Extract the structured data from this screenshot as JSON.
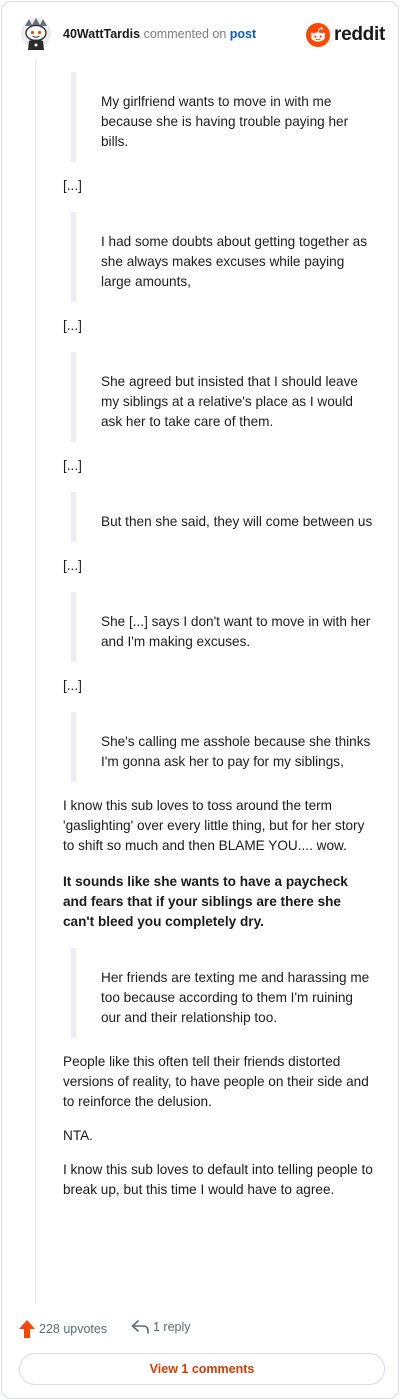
{
  "header": {
    "username": "40WattTardis",
    "action": "commented on",
    "post_link": "post",
    "brand": "reddit",
    "avatar_icon": "snoo-avatar-icon",
    "brand_icon": "reddit-logo-icon",
    "brand_color": "#ff4500"
  },
  "comment": {
    "quote1": "My girlfriend wants to move in with me because she is having trouble paying her bills.",
    "ellipsis1": "[...]",
    "quote2": "I had some doubts about getting together as she always makes excuses while paying large amounts,",
    "ellipsis2": "[...]",
    "quote3": "She agreed but insisted that I should leave my siblings at a relative's place as I would ask her to take care of them.",
    "ellipsis3": "[...]",
    "quote4": "But then she said, they will come between us",
    "ellipsis4": "[...]",
    "quote5": "She [...] says I don't want to move in with her and I'm making excuses.",
    "ellipsis5": "[...]",
    "quote6": "She's calling me asshole because she thinks I'm gonna ask her to pay for my siblings,",
    "para1": "I know this sub loves to toss around the term 'gaslighting' over every little thing, but for her story to shift so much and then BLAME YOU.... wow.",
    "para2_bold": "It sounds like she wants to have a paycheck and fears that if your siblings are there she can't bleed you completely dry.",
    "quote7": "Her friends are texting me and harassing me too because according to them I'm ruining our and their relationship too.",
    "para3": "People like this often tell their friends distorted versions of reality, to have people on their side and to reinforce the delusion.",
    "para4": "NTA.",
    "para5": "I know this sub loves to default into telling people to break up, but this time I would have to agree."
  },
  "footer": {
    "upvotes": "228 upvotes",
    "replies": "1 reply",
    "upvote_icon": "upvote-arrow-icon",
    "reply_icon": "reply-arrow-icon",
    "upvote_color": "#ff4500"
  },
  "view_button": "View 1 comments"
}
